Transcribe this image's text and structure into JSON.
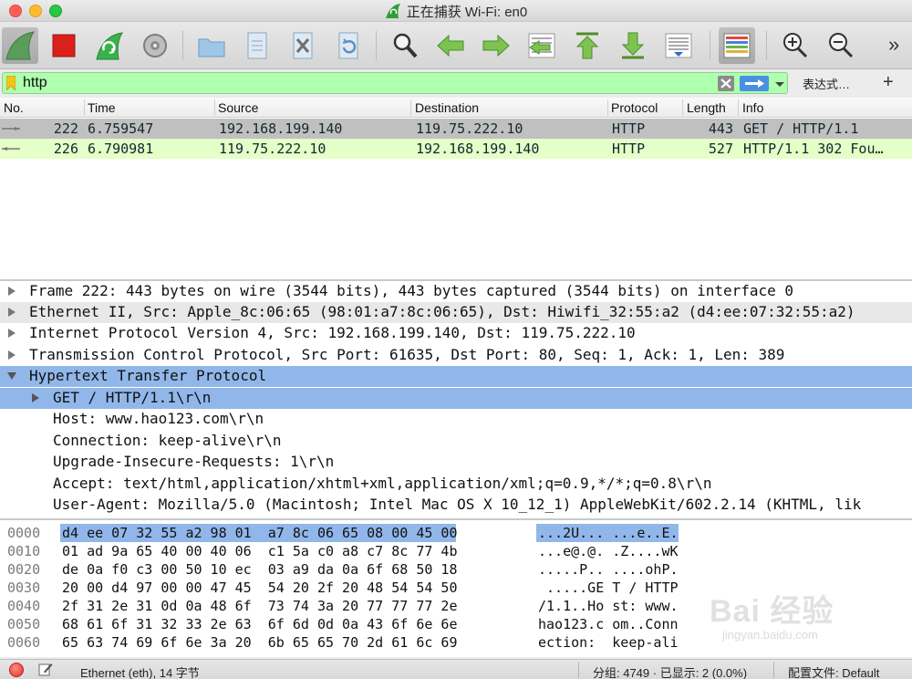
{
  "window": {
    "title": "正在捕获 Wi-Fi: en0"
  },
  "toolbar": {
    "icons": [
      "shark-fin-start-icon",
      "stop-capture-icon",
      "restart-capture-icon",
      "capture-options-icon",
      "open-file-icon",
      "save-file-icon",
      "close-file-icon",
      "reload-file-icon",
      "find-packet-icon",
      "go-back-icon",
      "go-forward-icon",
      "go-to-packet-icon",
      "go-first-icon",
      "go-last-icon",
      "auto-scroll-icon",
      "colorize-icon",
      "zoom-in-icon",
      "zoom-out-icon"
    ],
    "overflow": "»"
  },
  "filter": {
    "value": "http",
    "expression_label": "表达式…",
    "add_label": "+"
  },
  "packet_list": {
    "columns": [
      "No.",
      "Time",
      "Source",
      "Destination",
      "Protocol",
      "Length",
      "Info"
    ],
    "rows": [
      {
        "no": "222",
        "time": "6.759547",
        "source": "192.168.199.140",
        "destination": "119.75.222.10",
        "protocol": "HTTP",
        "length": "443",
        "info": "GET / HTTP/1.1"
      },
      {
        "no": "226",
        "time": "6.790981",
        "source": "119.75.222.10",
        "destination": "192.168.199.140",
        "protocol": "HTTP",
        "length": "527",
        "info": "HTTP/1.1 302 Fou…"
      }
    ]
  },
  "details": {
    "lines": [
      "Frame 222: 443 bytes on wire (3544 bits), 443 bytes captured (3544 bits) on interface 0",
      "Ethernet II, Src: Apple_8c:06:65 (98:01:a7:8c:06:65), Dst: Hiwifi_32:55:a2 (d4:ee:07:32:55:a2)",
      "Internet Protocol Version 4, Src: 192.168.199.140, Dst: 119.75.222.10",
      "Transmission Control Protocol, Src Port: 61635, Dst Port: 80, Seq: 1, Ack: 1, Len: 389",
      "Hypertext Transfer Protocol",
      "GET / HTTP/1.1\\r\\n",
      "Host: www.hao123.com\\r\\n",
      "Connection: keep-alive\\r\\n",
      "Upgrade-Insecure-Requests: 1\\r\\n",
      "Accept: text/html,application/xhtml+xml,application/xml;q=0.9,*/*;q=0.8\\r\\n",
      "User-Agent: Mozilla/5.0 (Macintosh; Intel Mac OS X 10_12_1) AppleWebKit/602.2.14 (KHTML, lik"
    ]
  },
  "bytes": {
    "lines": [
      {
        "offset": "0000",
        "hex": "d4 ee 07 32 55 a2 98 01  a7 8c 06 65 08 00 45 00",
        "ascii": "...2U... ...e..E."
      },
      {
        "offset": "0010",
        "hex": "01 ad 9a 65 40 00 40 06  c1 5a c0 a8 c7 8c 77 4b",
        "ascii": "...e@.@. .Z....wK"
      },
      {
        "offset": "0020",
        "hex": "de 0a f0 c3 00 50 10 ec  03 a9 da 0a 6f 68 50 18",
        "ascii": ".....P.. ....ohP."
      },
      {
        "offset": "0030",
        "hex": "20 00 d4 97 00 00 47 45  54 20 2f 20 48 54 54 50",
        "ascii": " .....GE T / HTTP"
      },
      {
        "offset": "0040",
        "hex": "2f 31 2e 31 0d 0a 48 6f  73 74 3a 20 77 77 77 2e",
        "ascii": "/1.1..Ho st: www."
      },
      {
        "offset": "0050",
        "hex": "68 61 6f 31 32 33 2e 63  6f 6d 0d 0a 43 6f 6e 6e",
        "ascii": "hao123.c om..Conn"
      },
      {
        "offset": "0060",
        "hex": "65 63 74 69 6f 6e 3a 20  6b 65 65 70 2d 61 6c 69",
        "ascii": "ection:  keep-ali"
      }
    ]
  },
  "watermark": {
    "line1": "Bai 经验",
    "line2": "jingyan.baidu.com"
  },
  "status": {
    "layer": "Ethernet (eth), 14 字节",
    "packets": "分组: 4749 · 已显示: 2 (0.0%)",
    "profile": "配置文件: Default"
  },
  "colors": {
    "filter_ok": "#afffaf",
    "selected_row": "#c0c0c0",
    "http_row": "#e4ffc7",
    "tree_selection": "#91b7ea"
  }
}
